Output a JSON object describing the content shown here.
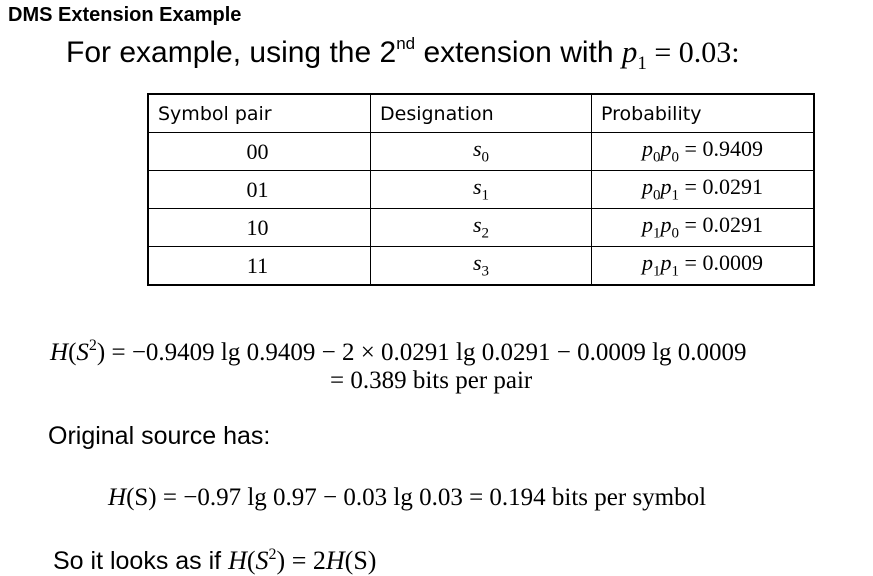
{
  "heading": "DMS Extension Example",
  "intro": {
    "lead": "For example, using the 2",
    "superscript": "nd",
    "mid": " extension with ",
    "var": "p",
    "sub": "1",
    "rest": " = 0.03:"
  },
  "table": {
    "headers": [
      "Symbol pair",
      "Designation",
      "Probability"
    ],
    "rows": [
      {
        "pair": "00",
        "des": "s",
        "des_sub": "0",
        "prob_a": "p",
        "prob_a_sub": "0",
        "prob_b": "p",
        "prob_b_sub": "0",
        "value": " = 0.9409"
      },
      {
        "pair": "01",
        "des": "s",
        "des_sub": "1",
        "prob_a": "p",
        "prob_a_sub": "0",
        "prob_b": "p",
        "prob_b_sub": "1",
        "value": " = 0.0291"
      },
      {
        "pair": "10",
        "des": "s",
        "des_sub": "2",
        "prob_a": "p",
        "prob_a_sub": "1",
        "prob_b": "p",
        "prob_b_sub": "0",
        "value": " = 0.0291"
      },
      {
        "pair": "11",
        "des": "s",
        "des_sub": "3",
        "prob_a": "p",
        "prob_a_sub": "1",
        "prob_b": "p",
        "prob_b_sub": "1",
        "value": " = 0.0009"
      }
    ]
  },
  "entropy_ext": {
    "lhs_var": "H",
    "lhs_open": "(",
    "lhs_arg": "S",
    "lhs_sup": "2",
    "lhs_close": ")",
    "rhs": " = −0.9409 lg 0.9409 − 2 × 0.0291 lg 0.0291 − 0.0009 lg 0.0009",
    "result": "= 0.389 bits per pair"
  },
  "original_label": "Original source has:",
  "entropy_orig": {
    "lhs_var": "H",
    "lhs_arg": "(S)",
    "rhs": " = −0.97 lg 0.97 − 0.03 lg 0.03 = 0.194 bits per symbol"
  },
  "conclusion": {
    "text": "So it looks as if ",
    "lhs_var": "H",
    "lhs_open": "(",
    "lhs_arg": "S",
    "lhs_sup": "2",
    "lhs_close": ")",
    "eq": " = 2",
    "rhs_var": "H",
    "rhs_arg": "(S)"
  }
}
